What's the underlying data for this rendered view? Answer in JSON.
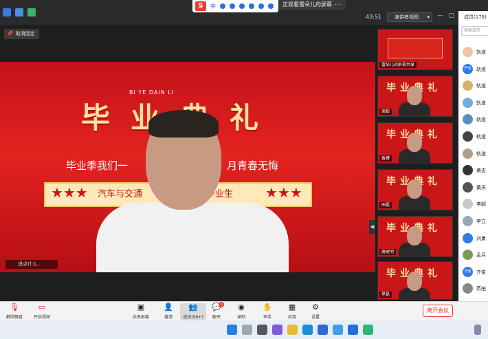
{
  "topbar": {
    "viewing_label": "正观看雷朵儿的屏幕",
    "timer": "43:51",
    "view_button": "演讲者视图",
    "ime_logo": "S",
    "ime_lang": "中"
  },
  "pin_label": "取消固定",
  "main_video": {
    "pinyin": "BI YE DAIN LI",
    "title": "毕业典礼",
    "slogan_left": "毕业季我们一",
    "slogan_right": "月青春无悔",
    "stars": "★★★",
    "strip_left": "汽车与交通",
    "strip_right": "毕业生",
    "whisper": "说点什么..."
  },
  "thumbnails": [
    {
      "name": "雷朵儿的屏幕共享",
      "type": "share"
    },
    {
      "name": "周毅",
      "type": "video"
    },
    {
      "name": "香健",
      "type": "video"
    },
    {
      "name": "田磊",
      "type": "video"
    },
    {
      "name": "唐建明",
      "type": "video"
    },
    {
      "name": "星磊",
      "type": "video"
    }
  ],
  "thumb_title": "毕业典礼",
  "panel": {
    "header": "成员(178)",
    "search_placeholder": "搜索成员",
    "participants": [
      {
        "name": "轨道",
        "avatar": "",
        "color": "#f3c1a0"
      },
      {
        "name": "轨道",
        "avatar": "严芳",
        "color": "#2f7be8"
      },
      {
        "name": "轨道",
        "avatar": "",
        "color": "#d7b26a"
      },
      {
        "name": "轨道",
        "avatar": "",
        "color": "#6fb0e0"
      },
      {
        "name": "轨道",
        "avatar": "",
        "color": "#5a8fc0"
      },
      {
        "name": "轨道",
        "avatar": "",
        "color": "#444"
      },
      {
        "name": "轨道",
        "avatar": "",
        "color": "#b0a08a"
      },
      {
        "name": "黄志",
        "avatar": "",
        "color": "#333"
      },
      {
        "name": "黄天",
        "avatar": "",
        "color": "#555"
      },
      {
        "name": "李超",
        "avatar": "",
        "color": "#c8c8c8"
      },
      {
        "name": "李立",
        "avatar": "",
        "color": "#9aa7b0"
      },
      {
        "name": "刘勇",
        "avatar": "",
        "color": "#2f7be8"
      },
      {
        "name": "孟月",
        "avatar": "",
        "color": "#7a9a5a"
      },
      {
        "name": "齐俊",
        "avatar": "齐俊",
        "color": "#2f7be8"
      },
      {
        "name": "芮柏",
        "avatar": "",
        "color": "#888"
      }
    ]
  },
  "toolbar": {
    "mute": "解除静音",
    "video": "开启视频",
    "share": "共享屏幕",
    "invite": "邀请",
    "members": "成员(99+)",
    "chat": "聊天",
    "chat_badge": "1",
    "record": "录制",
    "hand": "举手",
    "apps": "应用",
    "settings": "设置",
    "leave": "离开会议"
  }
}
